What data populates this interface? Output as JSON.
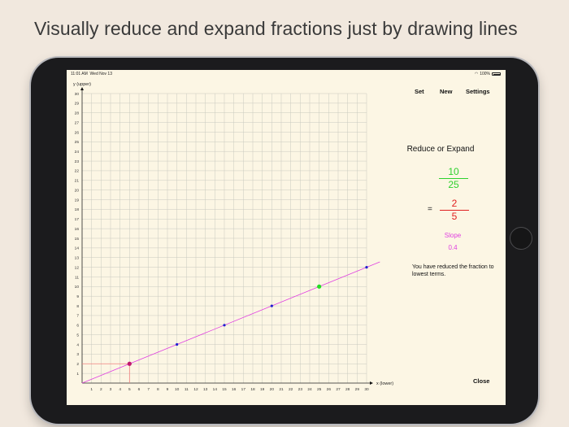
{
  "headline": "Visually reduce and expand fractions just by drawing lines",
  "status_bar": {
    "time": "11:01 AM",
    "date": "Wed Nov 13",
    "battery": "100%",
    "wifi_icon": "wifi-icon",
    "battery_icon": "battery-icon"
  },
  "nav": {
    "set_label": "Set",
    "new_label": "New",
    "settings_label": "Settings"
  },
  "panel": {
    "title": "Reduce or Expand",
    "fraction_original": {
      "numerator": "10",
      "denominator": "25"
    },
    "equals": "=",
    "fraction_reduced": {
      "numerator": "2",
      "denominator": "5"
    },
    "slope_label": "Slope",
    "slope_value": "0.4",
    "message": "You have reduced the fraction to lowest terms."
  },
  "close_label": "Close",
  "chart_data": {
    "type": "scatter",
    "xlabel": "x (lower)",
    "ylabel": "y (upper)",
    "xlim": [
      0,
      30
    ],
    "ylim": [
      0,
      30
    ],
    "grid": true,
    "x_ticks": [
      1,
      2,
      3,
      4,
      5,
      6,
      7,
      8,
      9,
      10,
      11,
      12,
      13,
      14,
      15,
      16,
      17,
      18,
      19,
      20,
      21,
      22,
      23,
      24,
      25,
      26,
      27,
      28,
      29,
      30
    ],
    "y_ticks": [
      1,
      2,
      3,
      4,
      5,
      6,
      7,
      8,
      9,
      10,
      11,
      12,
      13,
      14,
      15,
      16,
      17,
      18,
      19,
      20,
      21,
      22,
      23,
      24,
      25,
      26,
      27,
      28,
      29,
      30
    ],
    "line": {
      "slope": 0.4,
      "color": "#e040e0"
    },
    "points": [
      {
        "x": 5,
        "y": 2,
        "color": "#c0186e",
        "highlight": true
      },
      {
        "x": 10,
        "y": 4,
        "color": "#2020d0"
      },
      {
        "x": 15,
        "y": 6,
        "color": "#2020d0"
      },
      {
        "x": 20,
        "y": 8,
        "color": "#2020d0"
      },
      {
        "x": 25,
        "y": 10,
        "color": "#22dd22"
      },
      {
        "x": 30,
        "y": 12,
        "color": "#2020d0"
      }
    ],
    "guide_point": {
      "x": 5,
      "y": 2,
      "color": "#f08080"
    }
  }
}
